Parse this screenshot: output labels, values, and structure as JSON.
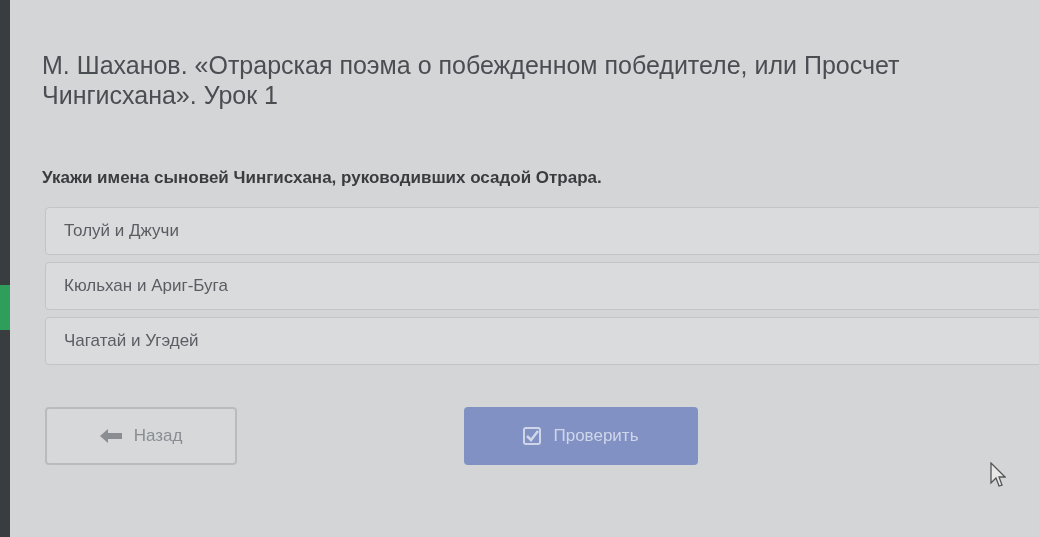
{
  "title": "М. Шаханов. «Отрарская поэма о побежденном победителе, или Просчет Чингисхана». Урок 1",
  "question": "Укажи имена сыновей Чингисхана, руководивших осадой Отрара.",
  "options": [
    {
      "label": "Толуй и Джучи",
      "selected": false
    },
    {
      "label": "Кюльхан и Ариг-Буга",
      "selected": false
    },
    {
      "label": "Чагатай и Угэдей",
      "selected": false
    }
  ],
  "back_button": {
    "label": "Назад"
  },
  "check_button": {
    "label": "Проверить",
    "disabled": true
  }
}
